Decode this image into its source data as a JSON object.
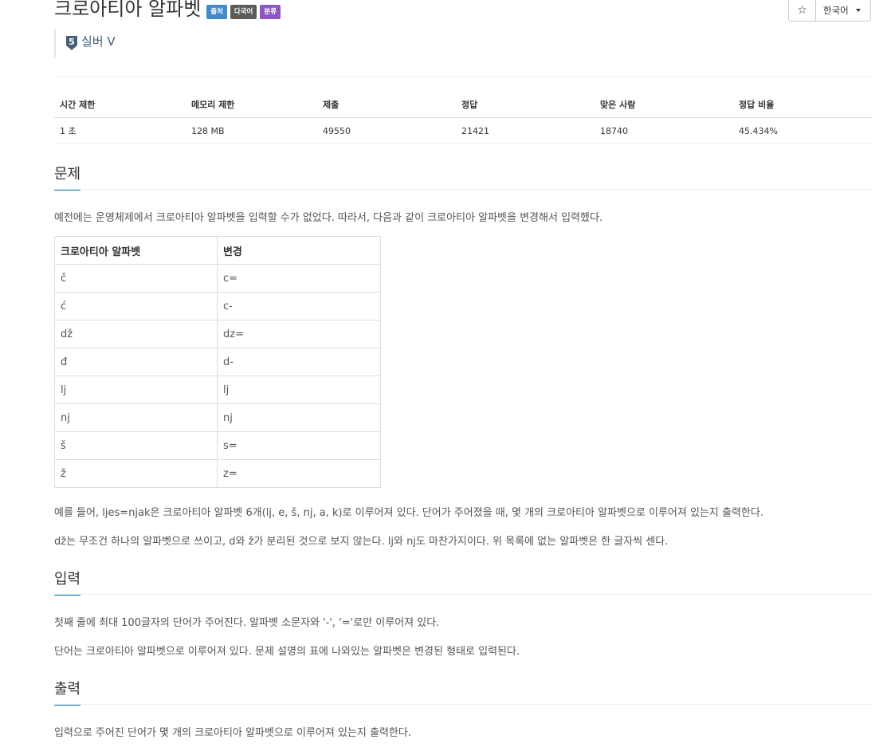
{
  "problem": {
    "title": "크로아티아 알파벳",
    "labels": {
      "source": "출처",
      "multilang": "다국어",
      "category": "분류"
    },
    "tier": {
      "number": "5",
      "text": "실버 V"
    }
  },
  "toolbar": {
    "star": "☆",
    "language": "한국어"
  },
  "info_table": {
    "headers": [
      "시간 제한",
      "메모리 제한",
      "제출",
      "정답",
      "맞은 사람",
      "정답 비율"
    ],
    "values": [
      "1 초",
      "128 MB",
      "49550",
      "21421",
      "18740",
      "45.434%"
    ]
  },
  "sections": {
    "problem": {
      "heading": "문제",
      "intro": "예전에는 운영체제에서 크로아티아 알파벳을 입력할 수가 없었다. 따라서, 다음과 같이 크로아티아 알파벳을 변경해서 입력했다.",
      "para1": "예를 들어, ljes=njak은 크로아티아 알파벳 6개(lj, e, š, nj, a, k)로 이루어져 있다. 단어가 주어졌을 때, 몇 개의 크로아티아 알파벳으로 이루어져 있는지 출력한다.",
      "para2": "dž는 무조건 하나의 알파벳으로 쓰이고, d와 ž가 분리된 것으로 보지 않는다. lj와 nj도 마찬가지이다. 위 목록에 없는 알파벳은 한 글자씩 센다."
    },
    "input": {
      "heading": "입력",
      "para1": "첫째 줄에 최대 100글자의 단어가 주어진다. 알파벳 소문자와 '-', '='로만 이루어져 있다.",
      "para2": "단어는 크로아티아 알파벳으로 이루어져 있다. 문제 설명의 표에 나와있는 알파벳은 변경된 형태로 입력된다."
    },
    "output": {
      "heading": "출력",
      "para1": "입력으로 주어진 단어가 몇 개의 크로아티아 알파벳으로 이루어져 있는지 출력한다."
    }
  },
  "alphabet_table": {
    "headers": [
      "크로아티아 알파벳",
      "변경"
    ],
    "rows": [
      [
        "č",
        "c="
      ],
      [
        "ć",
        "c-"
      ],
      [
        "dž",
        "dz="
      ],
      [
        "đ",
        "d-"
      ],
      [
        "lj",
        "lj"
      ],
      [
        "nj",
        "nj"
      ],
      [
        "š",
        "s="
      ],
      [
        "ž",
        "z="
      ]
    ]
  },
  "colors": {
    "source_label": "#428bca",
    "multilang_label": "#5b5b5b",
    "category_label": "#8e55c7",
    "tier_silver": "#435f7a",
    "section_underline": "#0076c0"
  }
}
